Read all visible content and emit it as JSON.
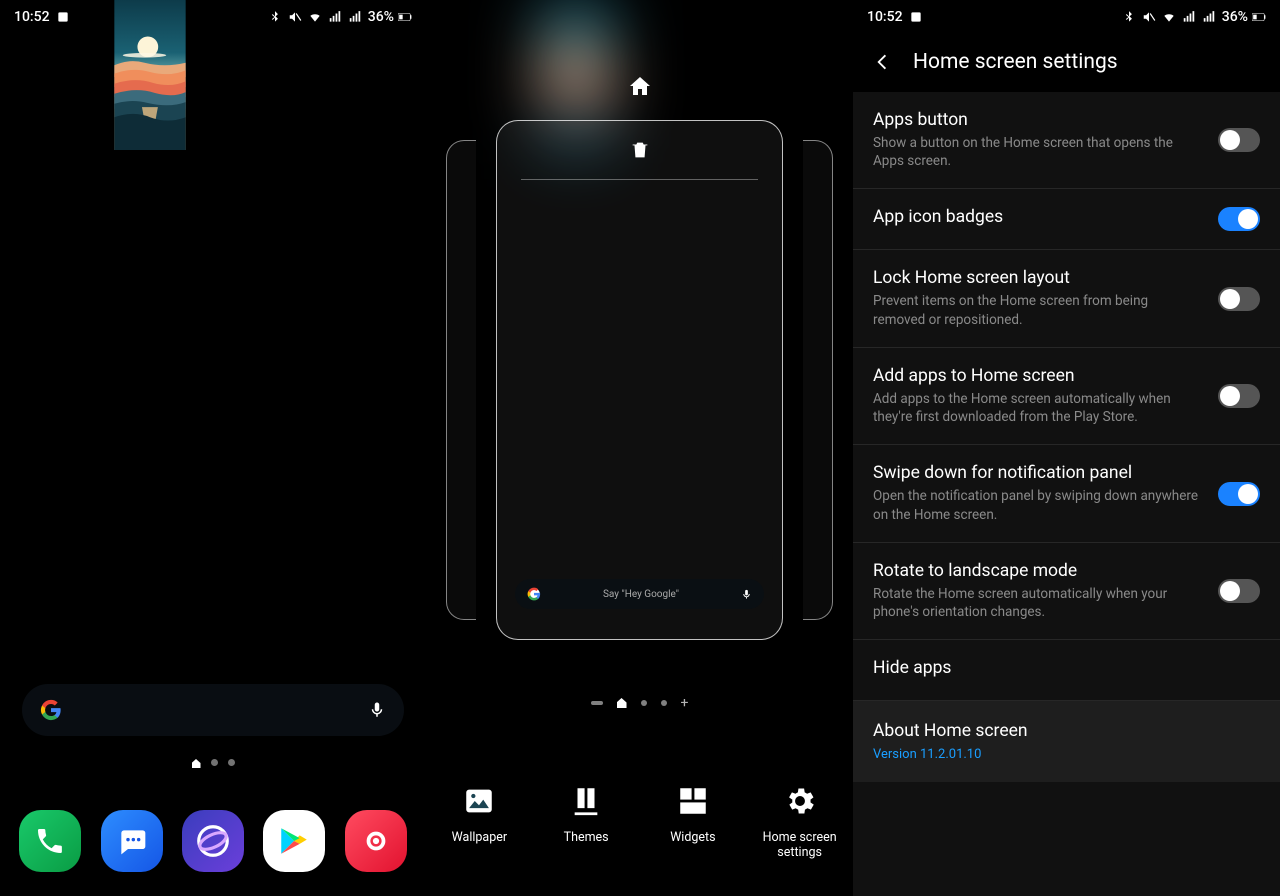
{
  "status": {
    "time": "10:52",
    "battery_pct": "36%"
  },
  "home": {
    "search_placeholder": "",
    "dock": [
      "phone",
      "messages",
      "browser",
      "play-store",
      "camera"
    ]
  },
  "editor": {
    "mini_search_hint": "Say \"Hey Google\"",
    "actions": [
      {
        "id": "wallpaper",
        "label": "Wallpaper"
      },
      {
        "id": "themes",
        "label": "Themes"
      },
      {
        "id": "widgets",
        "label": "Widgets"
      },
      {
        "id": "home-settings",
        "label": "Home screen settings"
      }
    ]
  },
  "settings": {
    "title": "Home screen settings",
    "items": [
      {
        "label": "Apps button",
        "desc": "Show a button on the Home screen that opens the Apps screen.",
        "on": false
      },
      {
        "label": "App icon badges",
        "desc": "",
        "on": true
      },
      {
        "label": "Lock Home screen layout",
        "desc": "Prevent items on the Home screen from being removed or repositioned.",
        "on": false
      },
      {
        "label": "Add apps to Home screen",
        "desc": "Add apps to the Home screen automatically when they're first downloaded from the Play Store.",
        "on": false
      },
      {
        "label": "Swipe down for notification panel",
        "desc": "Open the notification panel by swiping down anywhere on the Home screen.",
        "on": true
      },
      {
        "label": "Rotate to landscape mode",
        "desc": "Rotate the Home screen automatically when your phone's orientation changes.",
        "on": false
      }
    ],
    "hide_apps": "Hide apps",
    "about_label": "About Home screen",
    "about_version": "Version 11.2.01.10"
  }
}
